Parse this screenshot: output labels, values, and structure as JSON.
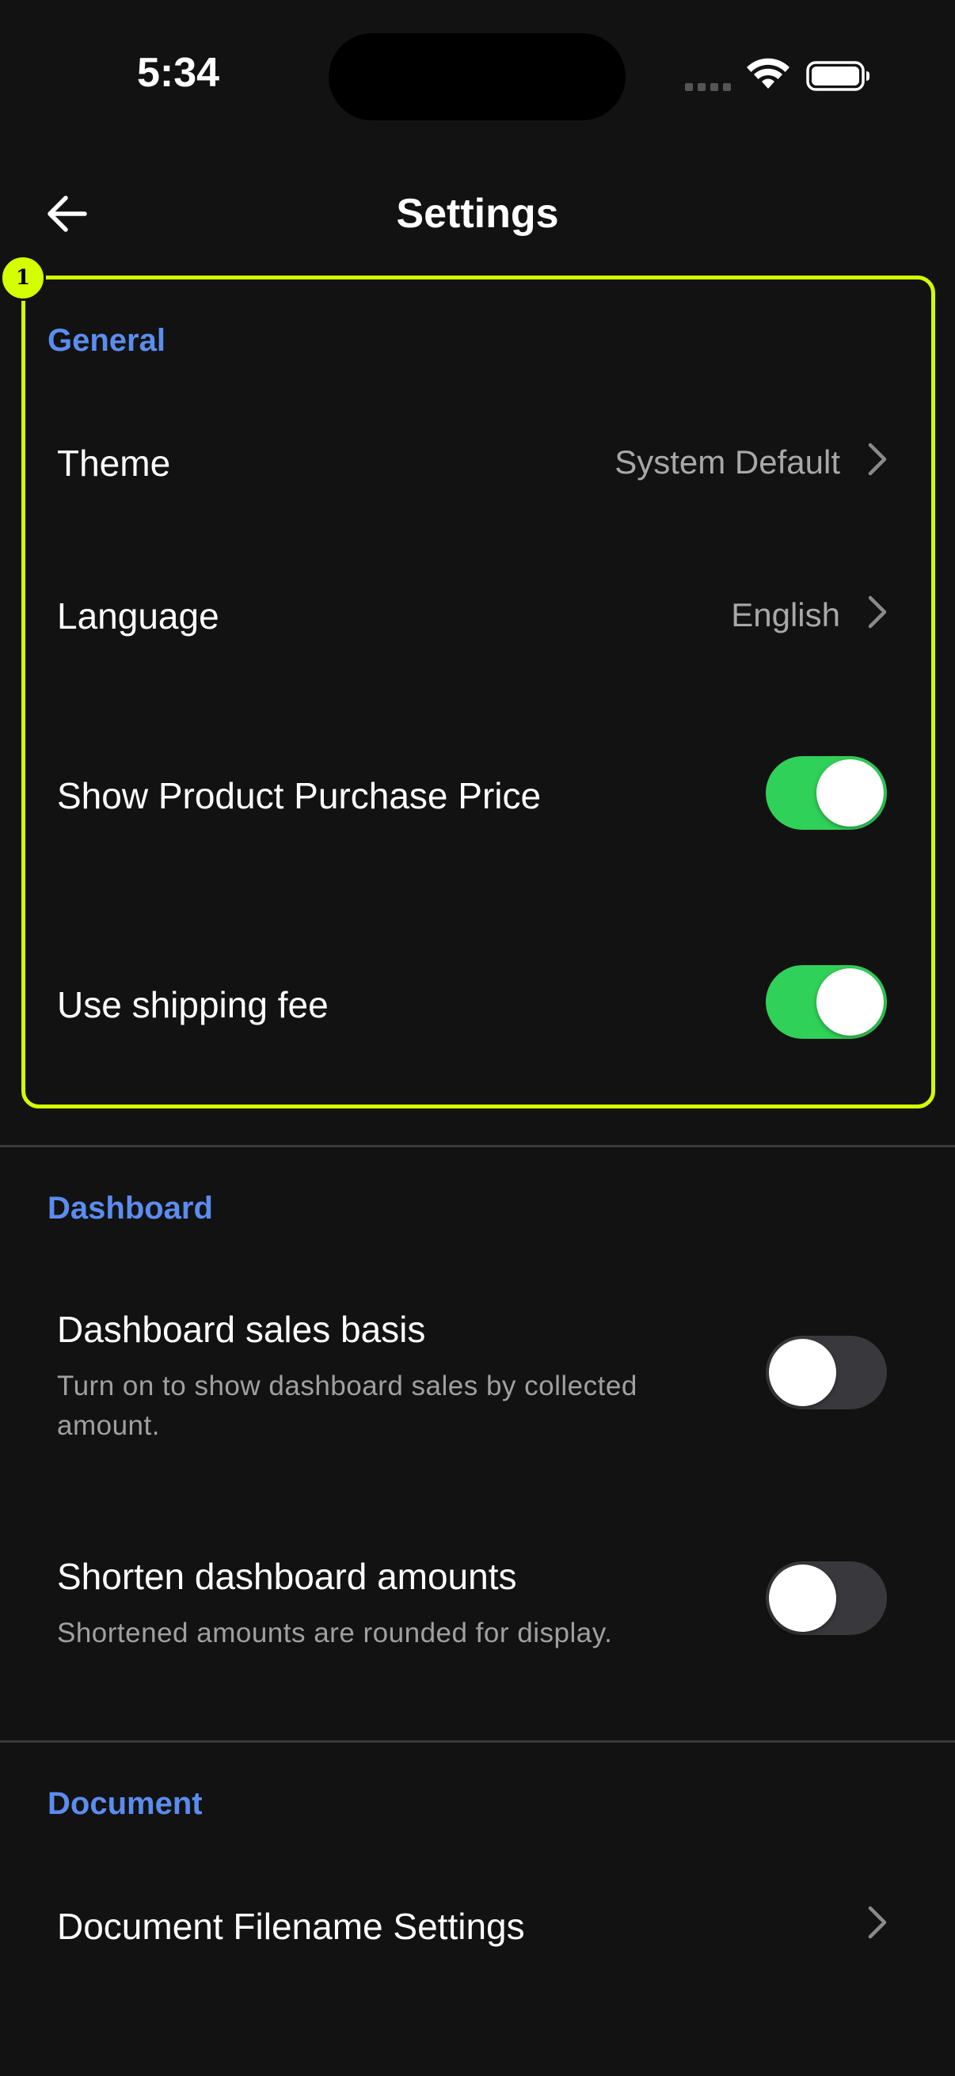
{
  "status_bar": {
    "time": "5:34"
  },
  "header": {
    "title": "Settings",
    "back_icon": "arrow-left-icon"
  },
  "highlight": {
    "badge": "1",
    "color": "#d4ff00"
  },
  "colors": {
    "accent": "#5b8def",
    "toggle_on": "#30d158",
    "toggle_off": "#39393d",
    "background": "#121212"
  },
  "sections": {
    "general": {
      "title": "General",
      "theme": {
        "label": "Theme",
        "value": "System Default"
      },
      "language": {
        "label": "Language",
        "value": "English"
      },
      "show_purchase_price": {
        "label": "Show Product Purchase Price",
        "enabled": true
      },
      "use_shipping_fee": {
        "label": "Use shipping fee",
        "enabled": true
      }
    },
    "dashboard": {
      "title": "Dashboard",
      "sales_basis": {
        "label": "Dashboard sales basis",
        "description": "Turn on to show dashboard sales by collected amount.",
        "enabled": false
      },
      "shorten_amounts": {
        "label": "Shorten dashboard amounts",
        "description": "Shortened amounts are rounded for display.",
        "enabled": false
      }
    },
    "document": {
      "title": "Document",
      "filename_settings": {
        "label": "Document Filename Settings"
      }
    }
  }
}
